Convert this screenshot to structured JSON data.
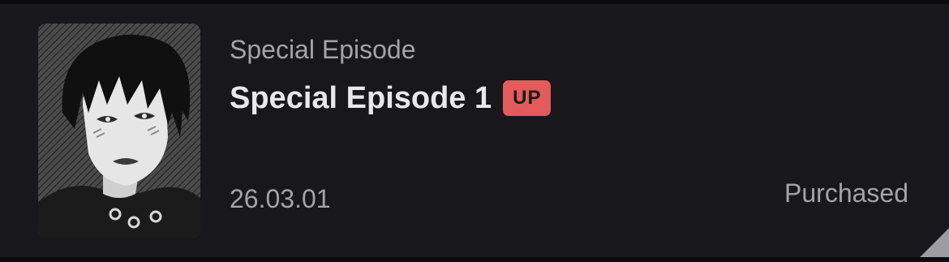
{
  "episode": {
    "series_label": "Special Episode",
    "title": "Special Episode 1",
    "badge": "UP",
    "date": "26.03.01",
    "status": "Purchased",
    "thumbnail_icon": "manga-character-thumbnail"
  },
  "colors": {
    "background": "#0e0e11",
    "row_background": "#18171c",
    "title_text": "#e8e8ec",
    "muted_text": "#a3a3a8",
    "badge_background": "#e45b5b",
    "badge_text": "#1a1a1a",
    "corner_fold": "#9c9ca2"
  }
}
